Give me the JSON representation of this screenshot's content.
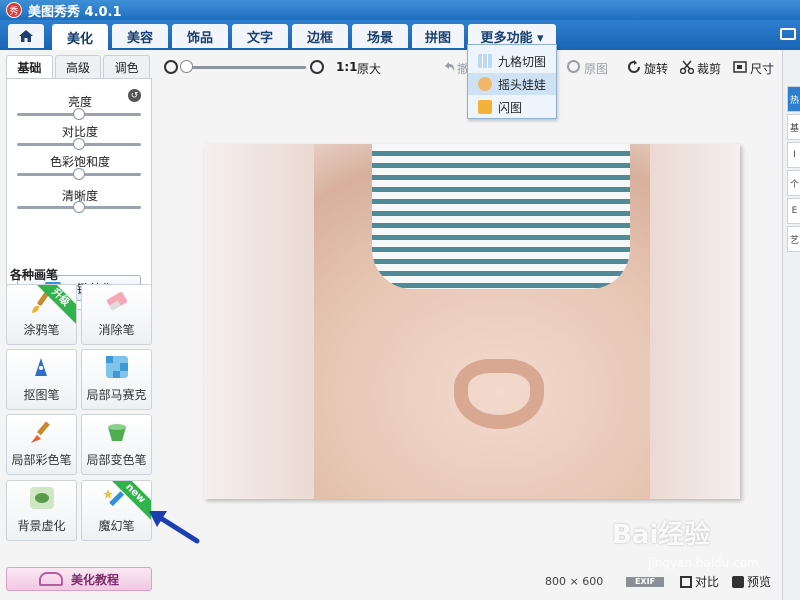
{
  "app": {
    "title": "美图秀秀 4.0.1",
    "logo_text": "秀"
  },
  "nav": {
    "tabs": [
      "美化",
      "美容",
      "饰品",
      "文字",
      "边框",
      "场景",
      "拼图",
      "更多功能 ▾"
    ]
  },
  "left_panel": {
    "subtabs": [
      "基础",
      "高级",
      "调色"
    ],
    "sliders": [
      {
        "label": "亮度",
        "value": 0.5
      },
      {
        "label": "对比度",
        "value": 0.5
      },
      {
        "label": "色彩饱和度",
        "value": 0.5
      },
      {
        "label": "清晰度",
        "value": 0.5
      }
    ],
    "one_click_label": "一键美化",
    "brush_section_title": "各种画笔",
    "brushes": [
      {
        "label": "涂鸦笔",
        "ribbon": "升级"
      },
      {
        "label": "消除笔",
        "ribbon": ""
      },
      {
        "label": "抠图笔",
        "ribbon": ""
      },
      {
        "label": "局部马赛克",
        "ribbon": ""
      },
      {
        "label": "局部彩色笔",
        "ribbon": ""
      },
      {
        "label": "局部变色笔",
        "ribbon": ""
      },
      {
        "label": "背景虚化",
        "ribbon": ""
      },
      {
        "label": "魔幻笔",
        "ribbon": "new"
      }
    ],
    "tutorial_label": "美化教程"
  },
  "toolbar": {
    "ratio_label": "1:1",
    "original_size_label": "原大",
    "undo_label": "撤",
    "original_label": "原图",
    "rotate_label": "旋转",
    "crop_label": "裁剪",
    "size_label": "尺寸"
  },
  "dropdown": {
    "items": [
      "九格切图",
      "摇头娃娃",
      "闪图"
    ]
  },
  "status": {
    "image_size": "800 × 600",
    "exif_label": "EXIF",
    "compare_label": "对比",
    "preview_label": "预览"
  },
  "right_strip": {
    "tabs": [
      "热",
      "基",
      "I",
      "个",
      "E",
      "艺"
    ]
  },
  "watermark": {
    "text": "Bai经验",
    "sub": "jingyan.baidu.com"
  },
  "colors": {
    "titlebar": "#1f6fc0",
    "accent": "#2f7fd0",
    "ribbon_green": "#2fb34a",
    "tutorial_pink": "#f1c9e3"
  }
}
